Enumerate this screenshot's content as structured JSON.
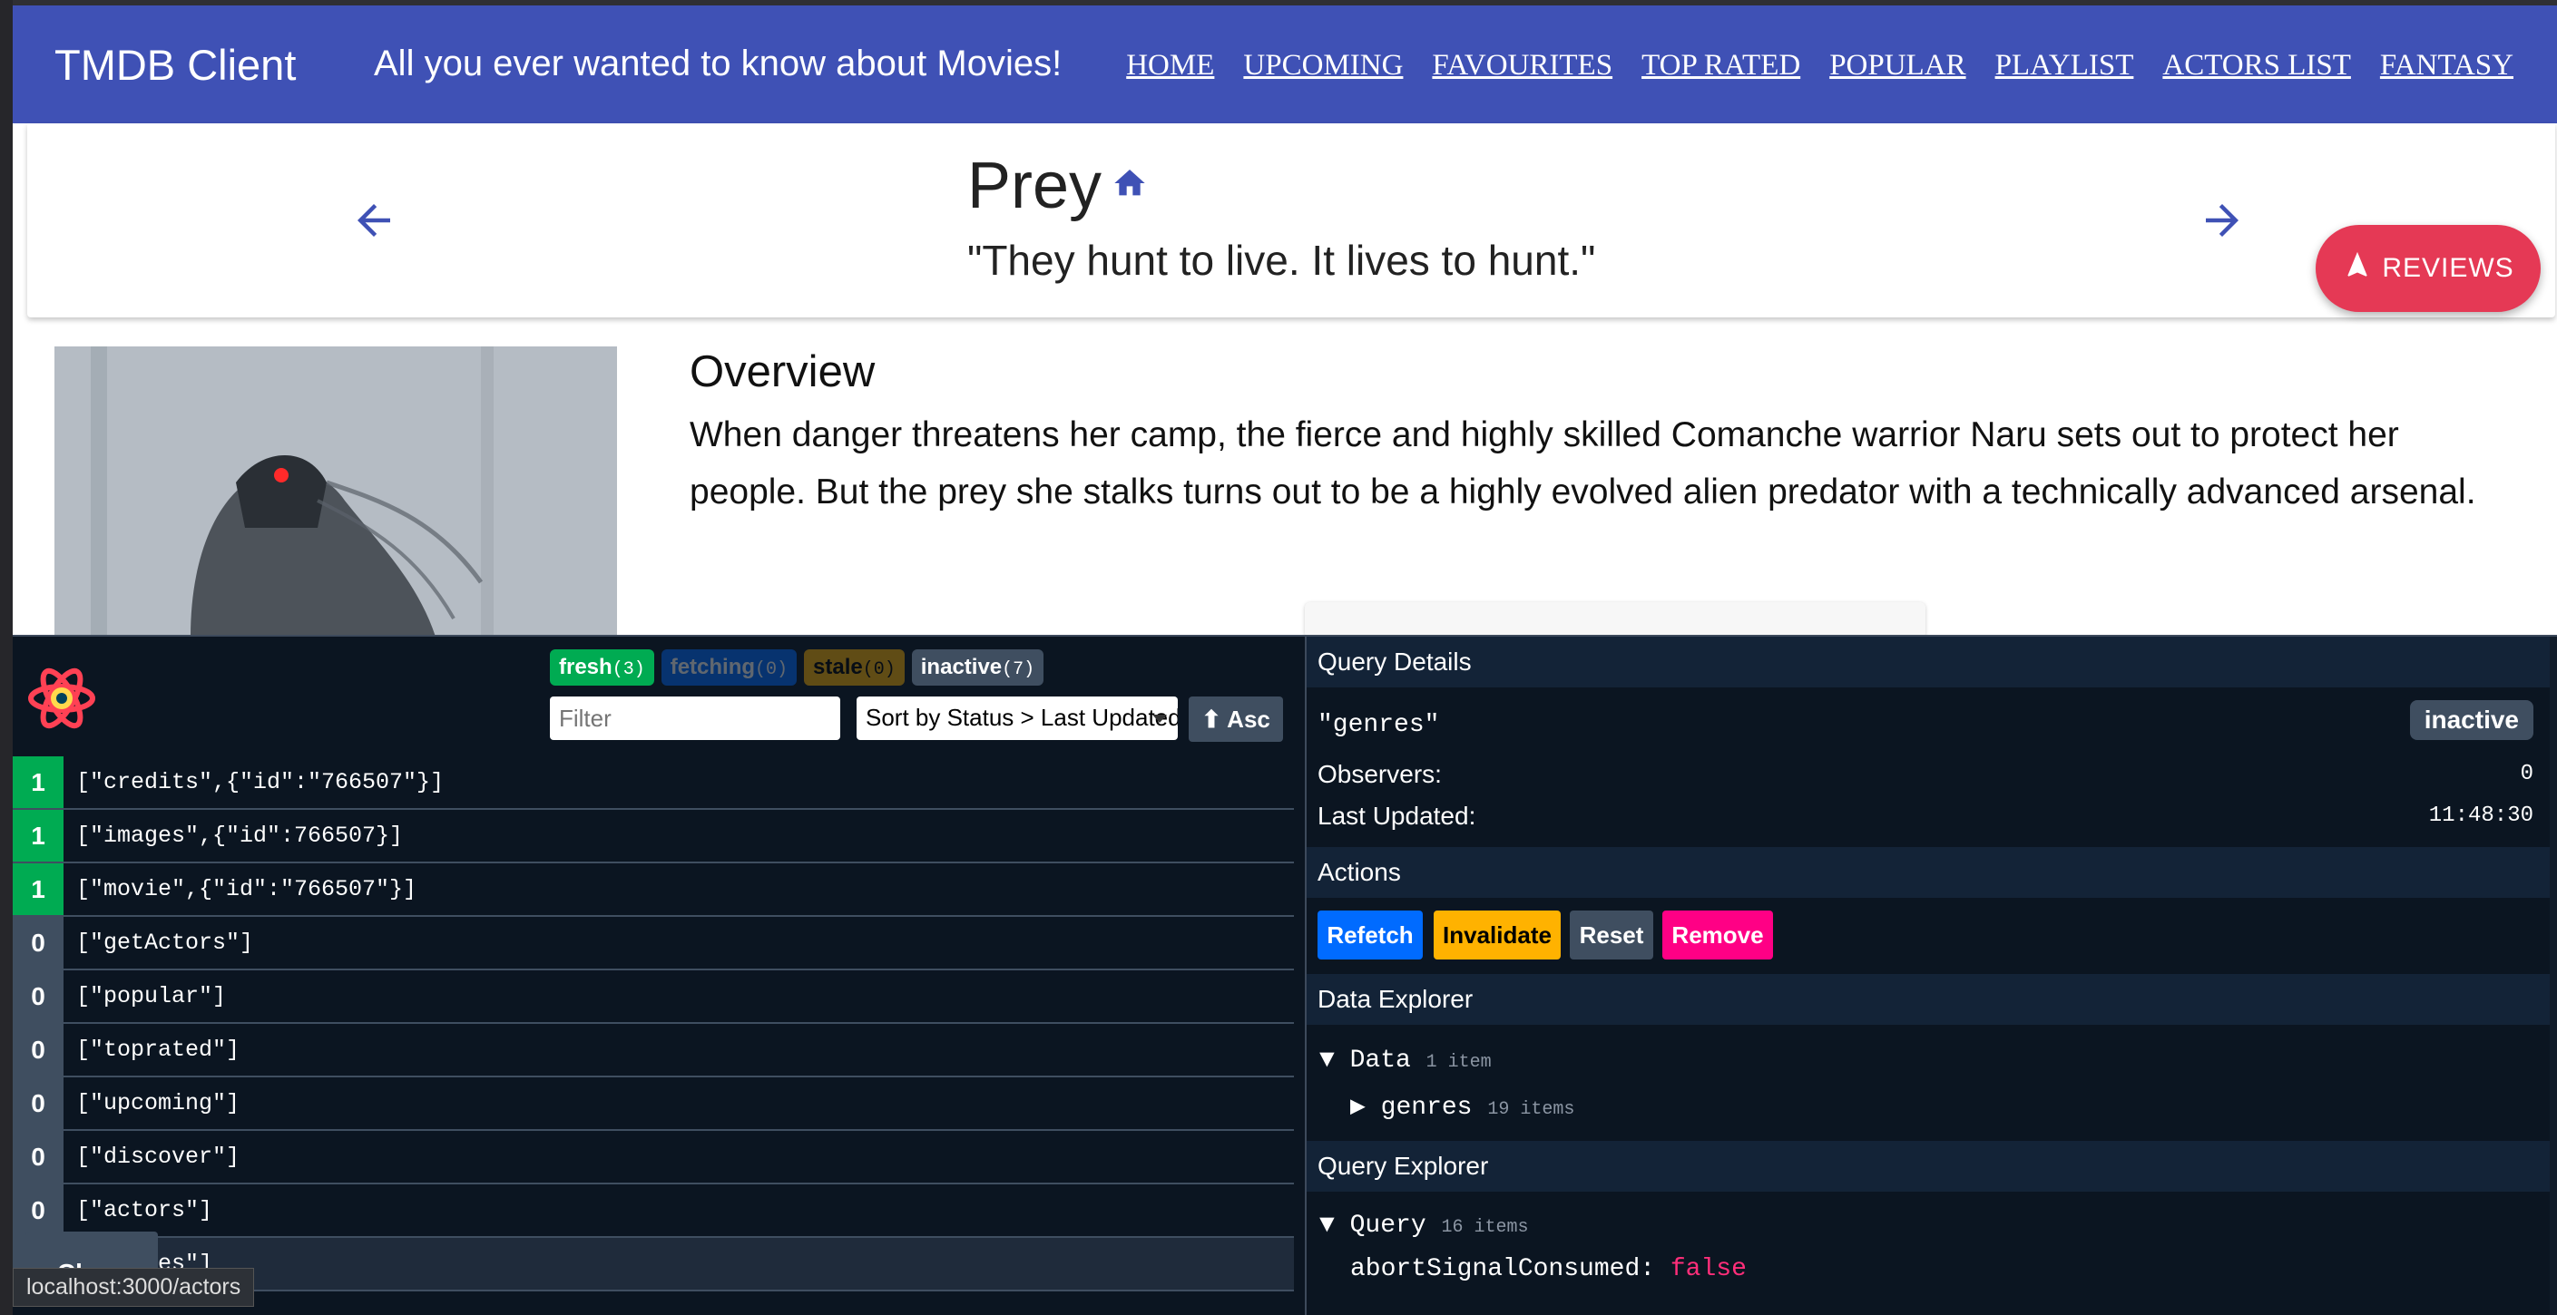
{
  "app": {
    "brand": "TMDB Client",
    "tagline": "All you ever wanted to know about Movies!",
    "nav": [
      "HOME",
      "UPCOMING",
      "FAVOURITES",
      "TOP RATED",
      "POPULAR",
      "PLAYLIST",
      "ACTORS LIST",
      "FANTASY"
    ],
    "primary_color": "#3f51b5"
  },
  "movie": {
    "title": "Prey",
    "tagline": "\"They hunt to live. It lives to hunt.\"",
    "reviews_label": "REVIEWS",
    "overview_heading": "Overview",
    "overview_text": "When danger threatens her camp, the fierce and highly skilled Comanche warrior Naru sets out to protect her people. But the prey she stalks turns out to be a highly evolved alien predator with a technically advanced arsenal."
  },
  "devtools": {
    "badges": {
      "fresh": {
        "label": "fresh",
        "count": "(3)"
      },
      "fetching": {
        "label": "fetching",
        "count": "(0)"
      },
      "stale": {
        "label": "stale",
        "count": "(0)"
      },
      "inactive": {
        "label": "inactive",
        "count": "(7)"
      }
    },
    "filter_placeholder": "Filter",
    "sort_label": "Sort by Status > Last Updated",
    "asc_label": "⬆ Asc",
    "queries": [
      {
        "count": "1",
        "key": "[\"credits\",{\"id\":\"766507\"}]",
        "status": "fresh"
      },
      {
        "count": "1",
        "key": "[\"images\",{\"id\":766507}]",
        "status": "fresh"
      },
      {
        "count": "1",
        "key": "[\"movie\",{\"id\":\"766507\"}]",
        "status": "fresh"
      },
      {
        "count": "0",
        "key": "[\"getActors\"]",
        "status": "inactive"
      },
      {
        "count": "0",
        "key": "[\"popular\"]",
        "status": "inactive"
      },
      {
        "count": "0",
        "key": "[\"toprated\"]",
        "status": "inactive"
      },
      {
        "count": "0",
        "key": "[\"upcoming\"]",
        "status": "inactive"
      },
      {
        "count": "0",
        "key": "[\"discover\"]",
        "status": "inactive"
      },
      {
        "count": "0",
        "key": "[\"actors\"]",
        "status": "inactive"
      },
      {
        "count": "0",
        "key": "[\"genres\"]",
        "status": "inactive"
      }
    ],
    "close_label": "Close",
    "status_url": "localhost:3000/actors",
    "details": {
      "heading": "Query Details",
      "query_key": "\"genres\"",
      "status": "inactive",
      "observers_label": "Observers:",
      "observers_value": "0",
      "updated_label": "Last Updated:",
      "updated_value": "11:48:30"
    },
    "actions": {
      "heading": "Actions",
      "refetch": "Refetch",
      "invalidate": "Invalidate",
      "reset": "Reset",
      "remove": "Remove"
    },
    "data_explorer": {
      "heading": "Data Explorer",
      "data_label": "Data",
      "data_count": "1 item",
      "genres_label": "genres",
      "genres_count": "19 items"
    },
    "query_explorer": {
      "heading": "Query Explorer",
      "query_label": "Query",
      "query_count": "16 items",
      "field_key": "abortSignalConsumed:",
      "field_value": "false"
    }
  }
}
